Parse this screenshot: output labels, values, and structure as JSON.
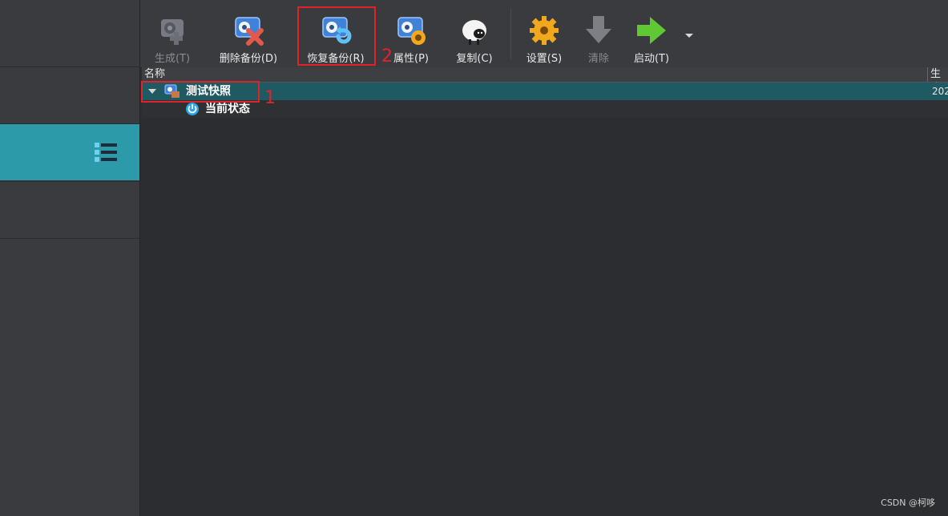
{
  "toolbar": {
    "buttons": [
      {
        "label": "生成(T)",
        "icon": "take-snapshot-icon",
        "enabled": false
      },
      {
        "label": "删除备份(D)",
        "icon": "delete-snapshot-icon",
        "enabled": true
      },
      {
        "label": "恢复备份(R)",
        "icon": "restore-snapshot-icon",
        "enabled": true
      },
      {
        "label": "属性(P)",
        "icon": "snapshot-properties-icon",
        "enabled": true
      },
      {
        "label": "复制(C)",
        "icon": "clone-sheep-icon",
        "enabled": true
      },
      {
        "label": "设置(S)",
        "icon": "settings-gear-icon",
        "enabled": true
      },
      {
        "label": "清除",
        "icon": "discard-arrow-icon",
        "enabled": false
      },
      {
        "label": "启动(T)",
        "icon": "start-arrow-icon",
        "enabled": true
      }
    ]
  },
  "table": {
    "columns": [
      "名称",
      "生成"
    ],
    "rows": [
      {
        "name": "测试快照",
        "date": "202",
        "selected": true,
        "icon": "snapshot-icon"
      },
      {
        "name": "当前状态",
        "date": "",
        "selected": false,
        "icon": "power-state-icon"
      }
    ]
  },
  "annotations": {
    "box1_number": "1",
    "box2_number": "2"
  },
  "watermark": "CSDN @柯哆",
  "colors": {
    "accent": "#2d9aa9",
    "selected_row": "#1f5a62",
    "annotation": "#e0232a"
  }
}
